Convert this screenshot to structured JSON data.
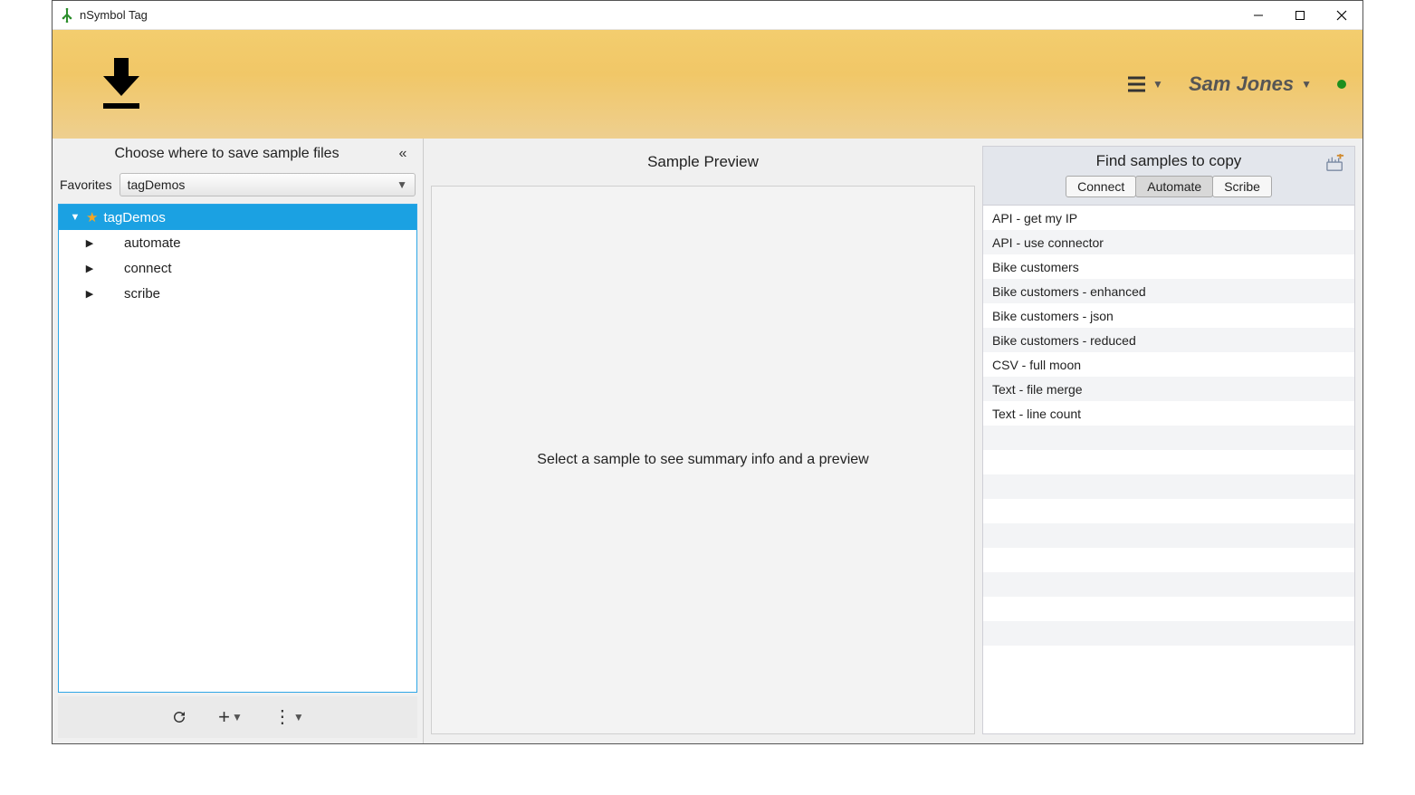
{
  "window": {
    "title": "nSymbol Tag"
  },
  "banner": {
    "user_name": "Sam Jones"
  },
  "left": {
    "title": "Choose where to save sample files",
    "favorites_label": "Favorites",
    "favorites_selected": "tagDemos",
    "tree": {
      "root": {
        "label": "tagDemos",
        "expanded": true,
        "favorite": true
      },
      "children": [
        {
          "label": "automate"
        },
        {
          "label": "connect"
        },
        {
          "label": "scribe"
        }
      ]
    }
  },
  "center": {
    "title": "Sample Preview",
    "placeholder": "Select a sample to see summary info and a preview"
  },
  "right": {
    "title": "Find samples to copy",
    "tabs": [
      {
        "label": "Connect",
        "selected": false
      },
      {
        "label": "Automate",
        "selected": true
      },
      {
        "label": "Scribe",
        "selected": false
      }
    ],
    "samples": [
      "API - get my IP",
      "API - use connector",
      "Bike customers",
      "Bike customers - enhanced",
      "Bike customers - json",
      "Bike customers - reduced",
      "CSV - full moon",
      "Text - file merge",
      "Text - line count"
    ]
  }
}
